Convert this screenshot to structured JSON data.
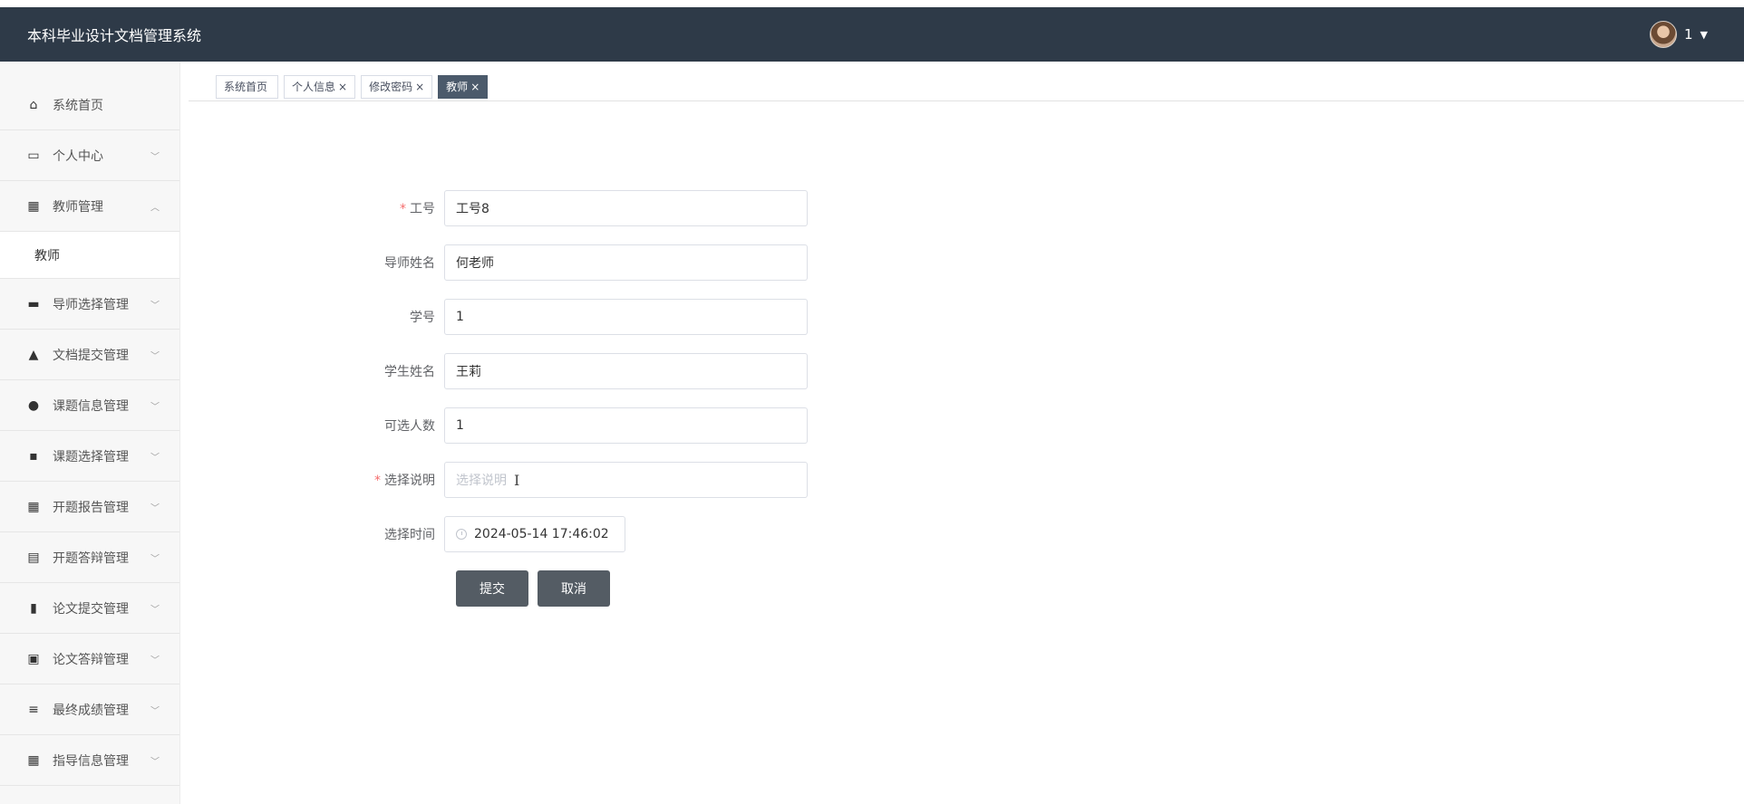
{
  "header": {
    "title": "本科毕业设计文档管理系统",
    "user": "1"
  },
  "sidebar": {
    "items": [
      {
        "label": "系统首页",
        "icon": "home-icon",
        "chev": ""
      },
      {
        "label": "个人中心",
        "icon": "profile-card-icon",
        "chev": "﹀"
      },
      {
        "label": "教师管理",
        "icon": "grid-icon",
        "chev": "︿"
      },
      {
        "label": "导师选择管理",
        "icon": "briefcase-icon",
        "chev": "﹀"
      },
      {
        "label": "文档提交管理",
        "icon": "thumbs-up-icon",
        "chev": "﹀"
      },
      {
        "label": "课题信息管理",
        "icon": "user-icon",
        "chev": "﹀"
      },
      {
        "label": "课题选择管理",
        "icon": "computer-icon",
        "chev": "﹀"
      },
      {
        "label": "开题报告管理",
        "icon": "grid-icon",
        "chev": "﹀"
      },
      {
        "label": "开题答辩管理",
        "icon": "clipboard-icon",
        "chev": "﹀"
      },
      {
        "label": "论文提交管理",
        "icon": "bar-chart-icon",
        "chev": "﹀"
      },
      {
        "label": "论文答辩管理",
        "icon": "clipboard-x-icon",
        "chev": "﹀"
      },
      {
        "label": "最终成绩管理",
        "icon": "list-icon",
        "chev": "﹀"
      },
      {
        "label": "指导信息管理",
        "icon": "grid-icon",
        "chev": "﹀"
      }
    ],
    "submenu": {
      "label": "教师"
    }
  },
  "tabs": [
    {
      "label": "系统首页",
      "close": ""
    },
    {
      "label": "个人信息",
      "close": "×"
    },
    {
      "label": "修改密码",
      "close": "×"
    },
    {
      "label": "教师",
      "close": "×"
    }
  ],
  "form": {
    "fields": [
      {
        "label": "工号",
        "value": "工号8",
        "required": "*"
      },
      {
        "label": "导师姓名",
        "value": "何老师",
        "required": ""
      },
      {
        "label": "学号",
        "value": "1",
        "required": ""
      },
      {
        "label": "学生姓名",
        "value": "王莉",
        "required": ""
      },
      {
        "label": "可选人数",
        "value": "1",
        "required": ""
      },
      {
        "label": "选择说明",
        "placeholder": "选择说明",
        "required": "*"
      },
      {
        "label": "选择时间",
        "value": "2024-05-14 17:46:02",
        "required": ""
      }
    ],
    "submit": "提交",
    "cancel": "取消"
  }
}
